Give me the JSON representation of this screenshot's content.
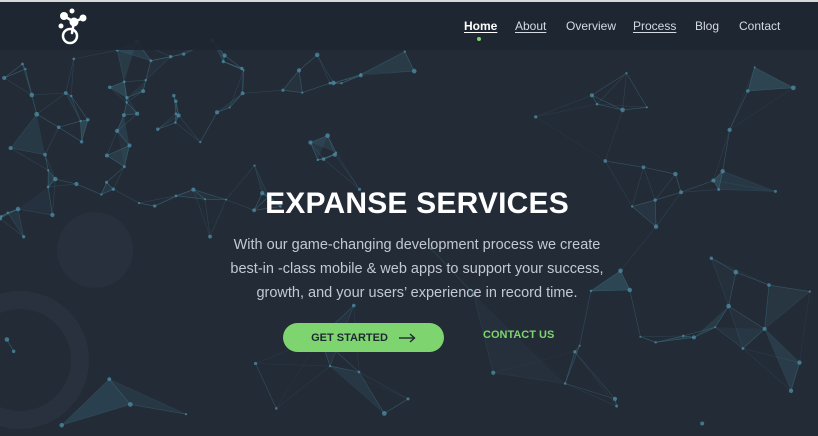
{
  "nav": {
    "items": [
      {
        "label": "Home"
      },
      {
        "label": "About"
      },
      {
        "label": "Overview"
      },
      {
        "label": "Process"
      },
      {
        "label": "Blog"
      },
      {
        "label": "Contact"
      }
    ]
  },
  "hero": {
    "title": "EXPANSE SERVICES",
    "subtitle_lines": [
      "With our game-changing development process we create",
      "best-in -class mobile & web apps to support your success,",
      "growth, and your users’ experience in record time."
    ],
    "primary_button": "GET STARTED",
    "secondary_button": "CONTACT US"
  },
  "icons": {
    "logo": "molecule-logo-icon",
    "button_arrow": "arrow-right-icon"
  },
  "colors": {
    "background": "#232b37",
    "accent": "#7ed56f",
    "network": "#3f6f7f"
  }
}
